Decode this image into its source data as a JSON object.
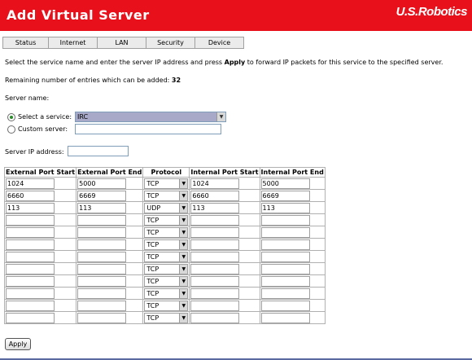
{
  "header": {
    "title": "Add Virtual Server",
    "logo": "U.S.Robotics"
  },
  "tabs": [
    "Status",
    "Internet",
    "LAN",
    "Security",
    "Device"
  ],
  "intro": {
    "before": "Select the service name and enter the server IP address and press ",
    "bold": "Apply",
    "after": " to forward IP packets for this service to the specified server."
  },
  "remaining": {
    "label": "Remaining number of entries which can be added:",
    "value": "32"
  },
  "server_name_label": "Server name:",
  "select_service": {
    "label": "Select a service:",
    "value": "IRC",
    "selected": true
  },
  "custom_server": {
    "label": "Custom server:",
    "value": "",
    "selected": false
  },
  "server_ip": {
    "label": "Server IP address:",
    "value": ""
  },
  "table": {
    "headers": [
      "External Port Start",
      "External Port End",
      "Protocol",
      "Internal Port Start",
      "Internal Port End"
    ],
    "rows": [
      [
        "1024",
        "5000",
        "TCP",
        "1024",
        "5000"
      ],
      [
        "6660",
        "6669",
        "TCP",
        "6660",
        "6669"
      ],
      [
        "113",
        "113",
        "UDP",
        "113",
        "113"
      ],
      [
        "",
        "",
        "TCP",
        "",
        ""
      ],
      [
        "",
        "",
        "TCP",
        "",
        ""
      ],
      [
        "",
        "",
        "TCP",
        "",
        ""
      ],
      [
        "",
        "",
        "TCP",
        "",
        ""
      ],
      [
        "",
        "",
        "TCP",
        "",
        ""
      ],
      [
        "",
        "",
        "TCP",
        "",
        ""
      ],
      [
        "",
        "",
        "TCP",
        "",
        ""
      ],
      [
        "",
        "",
        "TCP",
        "",
        ""
      ],
      [
        "",
        "",
        "TCP",
        "",
        ""
      ]
    ]
  },
  "apply_label": "Apply",
  "colors": {
    "header": "#e8101a",
    "select_highlight": "#a8a8c8"
  }
}
